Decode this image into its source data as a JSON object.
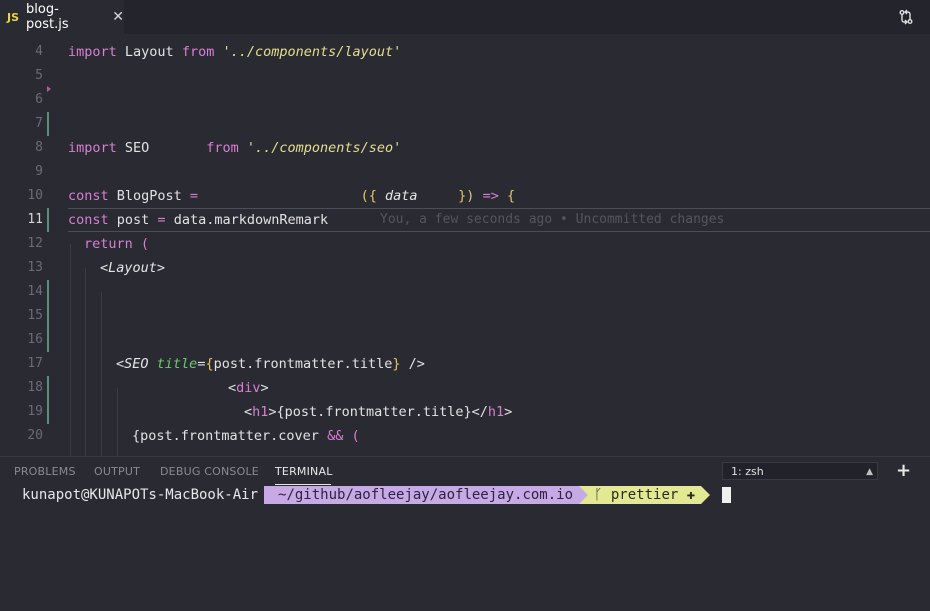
{
  "tab": {
    "lang_badge": "JS",
    "title": "blog-post.js",
    "close": "✕"
  },
  "toolbar": {
    "compare_icon": "git-compare-icon"
  },
  "editor": {
    "line_numbers": [
      "4",
      "5",
      "6",
      "7",
      "8",
      "9",
      "10",
      "11",
      "12",
      "13",
      "14",
      "15",
      "16",
      "17",
      "18",
      "19",
      "20"
    ],
    "lines": {
      "l4": {
        "a": "import",
        "b": " Layout ",
        "c": "from",
        "d": " '../components/layout'"
      },
      "l8": {
        "a": "import",
        "b": " SEO       ",
        "c": "from",
        "d": " '../components/seo'"
      },
      "l10": {
        "a": "const",
        "b": " BlogPost ",
        "c": "=",
        "d": "                    ",
        "e": "({",
        "f": " data     ",
        "g": "})",
        "h": " => ",
        "i": "{"
      },
      "l11": {
        "a": "const",
        "b": " post ",
        "c": "=",
        "d": " data.markdownRemark"
      },
      "l12": {
        "a": "return",
        "b": " ("
      },
      "l13": {
        "a": "<",
        "b": "Layout",
        "c": ">"
      },
      "l17": {
        "a": "<",
        "b": "SEO",
        "c": " title",
        "d": "=",
        "e": "{",
        "f": "post.frontmatter.title",
        "g": "}",
        "h": " />"
      },
      "l18": {
        "a": "<",
        "b": "div",
        "c": ">"
      },
      "l19": {
        "a": "<",
        "b": "h1",
        "c": ">",
        "d": "{post.frontmatter.title}",
        "e": "</",
        "f": "h1",
        "g": ">"
      },
      "l20": {
        "a": "{post.frontmatter.cover ",
        "b": "&&",
        "c": " ("
      }
    },
    "blame": "You, a few seconds ago • Uncommitted changes"
  },
  "panel": {
    "tabs": [
      "PROBLEMS",
      "OUTPUT",
      "DEBUG CONSOLE",
      "TERMINAL"
    ],
    "active_tab": "TERMINAL",
    "terminal_select": "1: zsh",
    "add_label": "+"
  },
  "terminal": {
    "user": "kunapot@KUNAPOTs-MacBook-Air",
    "path": "~/github/aofleejay/aofleejay.com.io",
    "branch": "prettier",
    "branch_status": "✚"
  },
  "colors": {
    "dir_segment": "#c7a9e6",
    "git_segment": "#e3e893",
    "keyword": "#d97fd1",
    "string": "#e5de8f"
  }
}
